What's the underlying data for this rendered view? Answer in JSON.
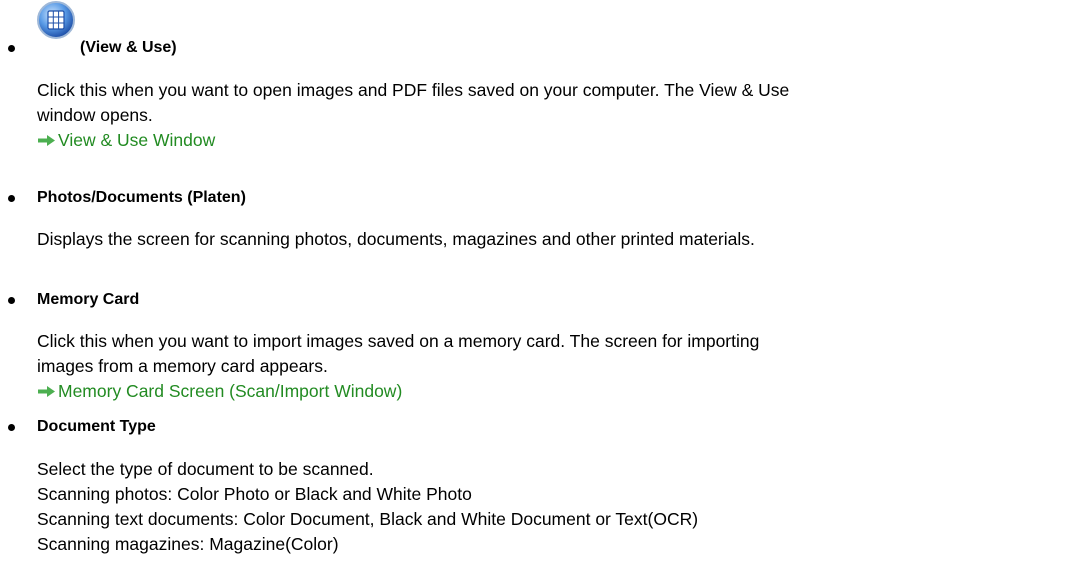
{
  "items": [
    {
      "title": "(View & Use)",
      "icon": "view-and-use-icon",
      "description_lines": [
        "Click this when you want to open images and PDF files saved on your computer. The View & Use",
        "window opens."
      ],
      "link": "View & Use Window"
    },
    {
      "title": "Photos/Documents (Platen)",
      "description_lines": [
        "Displays the screen for scanning photos, documents, magazines and other printed materials."
      ]
    },
    {
      "title": "Memory Card",
      "description_lines": [
        "Click this when you want to import images saved on a memory card. The screen for importing",
        "images from a memory card appears."
      ],
      "link": "Memory Card Screen (Scan/Import Window)"
    },
    {
      "title": "Document Type",
      "description_lines": [
        "Select the type of document to be scanned.",
        "Scanning photos: Color Photo or Black and White Photo",
        "Scanning text documents: Color Document, Black and White Document or Text(OCR)",
        "Scanning magazines: Magazine(Color)"
      ]
    }
  ],
  "colors": {
    "link": "#228b22",
    "arrow": "#4caf50",
    "icon_blue": "#2f6fd0"
  }
}
